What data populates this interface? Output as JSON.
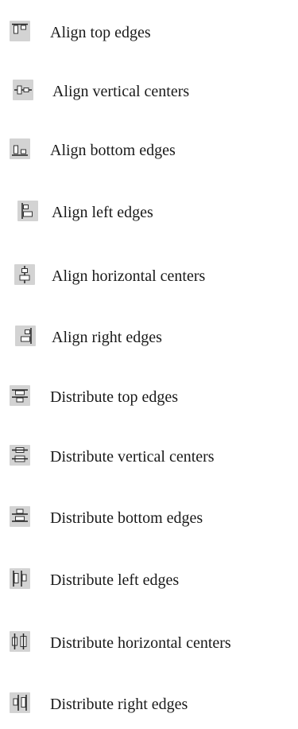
{
  "commands": [
    {
      "icon": "align-top-edges-icon",
      "label": "Align top edges"
    },
    {
      "icon": "align-vertical-centers-icon",
      "label": "Align vertical centers"
    },
    {
      "icon": "align-bottom-edges-icon",
      "label": "Align bottom edges"
    },
    {
      "icon": "align-left-edges-icon",
      "label": "Align left edges"
    },
    {
      "icon": "align-horizontal-centers-icon",
      "label": "Align horizontal centers"
    },
    {
      "icon": "align-right-edges-icon",
      "label": "Align right edges"
    },
    {
      "icon": "distribute-top-edges-icon",
      "label": "Distribute top edges"
    },
    {
      "icon": "distribute-vertical-centers-icon",
      "label": "Distribute vertical centers"
    },
    {
      "icon": "distribute-bottom-edges-icon",
      "label": "Distribute bottom edges"
    },
    {
      "icon": "distribute-left-edges-icon",
      "label": "Distribute left edges"
    },
    {
      "icon": "distribute-horizontal-centers-icon",
      "label": "Distribute horizontal centers"
    },
    {
      "icon": "distribute-right-edges-icon",
      "label": "Distribute right edges"
    }
  ]
}
